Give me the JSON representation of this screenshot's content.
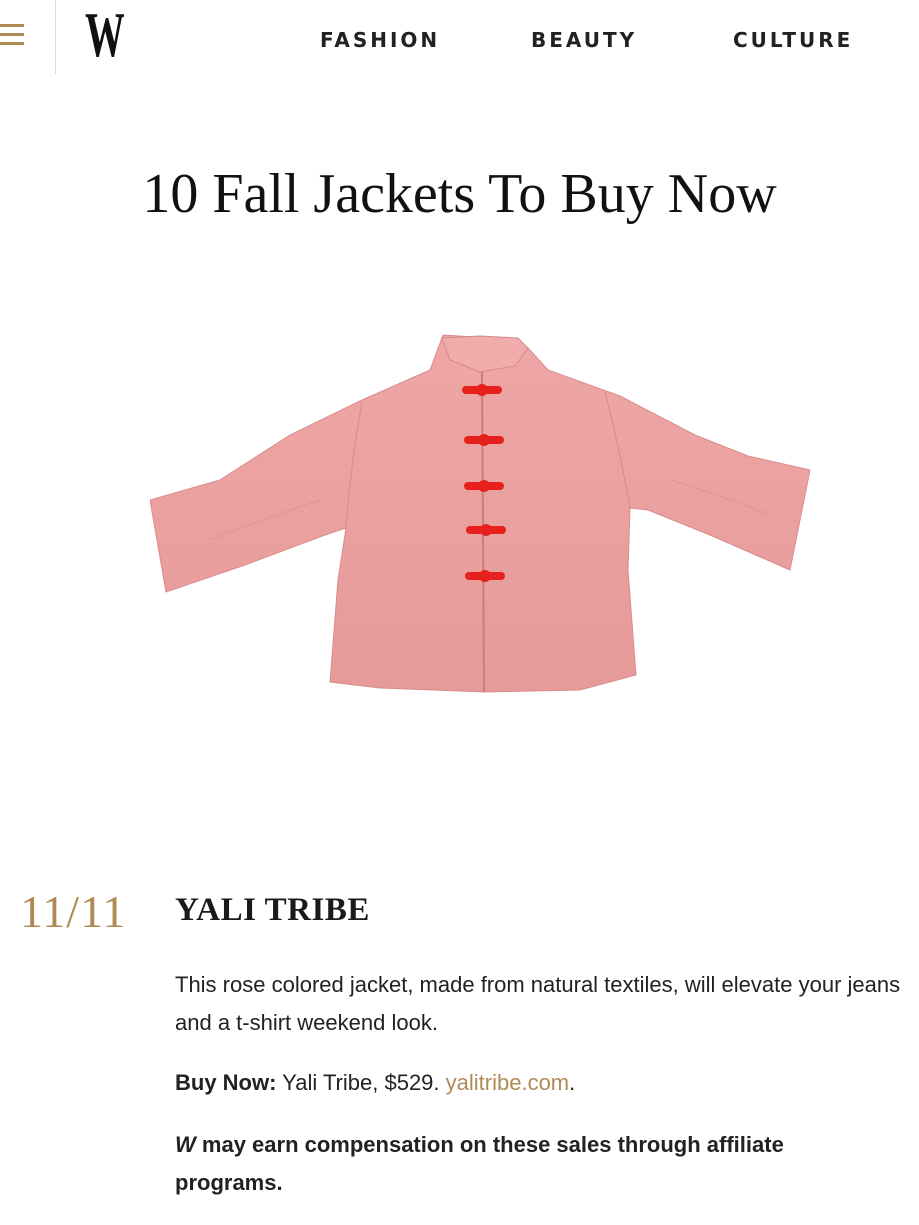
{
  "header": {
    "nav": [
      {
        "label": "FASHION"
      },
      {
        "label": "BEAUTY"
      },
      {
        "label": "CULTURE"
      }
    ]
  },
  "article": {
    "title": "10 Fall Jackets To Buy Now",
    "slide": {
      "counter": "11/11",
      "brand": "YALI TRIBE",
      "description": "This rose colored jacket, made from natural textiles, will elevate your jeans and a t-shirt weekend look.",
      "buy_label": "Buy Now:",
      "buy_text": "Yali Tribe, $529.",
      "buy_link": "yalitribe.com",
      "buy_end": ".",
      "disclaimer_w": "W",
      "disclaimer_text": "may earn compensation on these sales through affiliate programs."
    }
  },
  "colors": {
    "accent": "#b08a55",
    "jacket": "#eaa0a0",
    "frog_buttons": "#e8201c"
  }
}
